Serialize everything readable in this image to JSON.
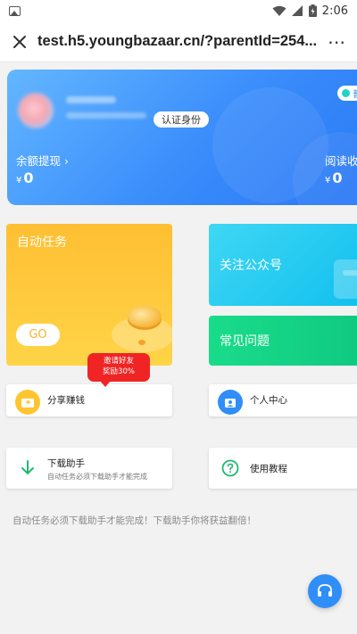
{
  "status_bar": {
    "time": "2:06",
    "icons": [
      "image-icon",
      "wifi-icon",
      "signal-icon",
      "battery-icon"
    ]
  },
  "browser": {
    "url": "test.h5.youngbazaar.cn/?parentId=254...",
    "close_icon": "close-icon",
    "more_icon": "more-icon",
    "more_label": "⋯"
  },
  "profile": {
    "verify_label": "认证身份",
    "vip_label": "普",
    "balance_label": "余额提现",
    "balance_chevron": "›",
    "balance_currency": "¥",
    "balance_value": "0",
    "reading_label": "阅读收益",
    "reading_currency": "¥",
    "reading_value": "0"
  },
  "cards": {
    "auto_task": {
      "title": "自动任务",
      "go_label": "GO"
    },
    "follow": {
      "title": "关注公众号"
    },
    "faq": {
      "title": "常见问题"
    }
  },
  "invite_bubble": {
    "line1": "邀请好友",
    "line2": "奖励30%"
  },
  "tiles": {
    "share": {
      "label": "分享赚钱",
      "icon": "share-icon"
    },
    "personal": {
      "label": "个人中心",
      "icon": "user-icon"
    },
    "download": {
      "label": "下载助手",
      "sub": "自动任务必须下载助手才能完成",
      "icon": "download-icon"
    },
    "tutorial": {
      "label": "使用教程",
      "icon": "help-icon"
    }
  },
  "notice": "自动任务必须下载助手才能完成！下载助手你将获益翻倍！",
  "float_button": {
    "icon": "headset-icon"
  },
  "colors": {
    "primary": "#2f8ef7",
    "auto_task": "#ffc43a",
    "follow": "#22c9f1",
    "faq": "#15d486",
    "invite": "#f02424"
  }
}
